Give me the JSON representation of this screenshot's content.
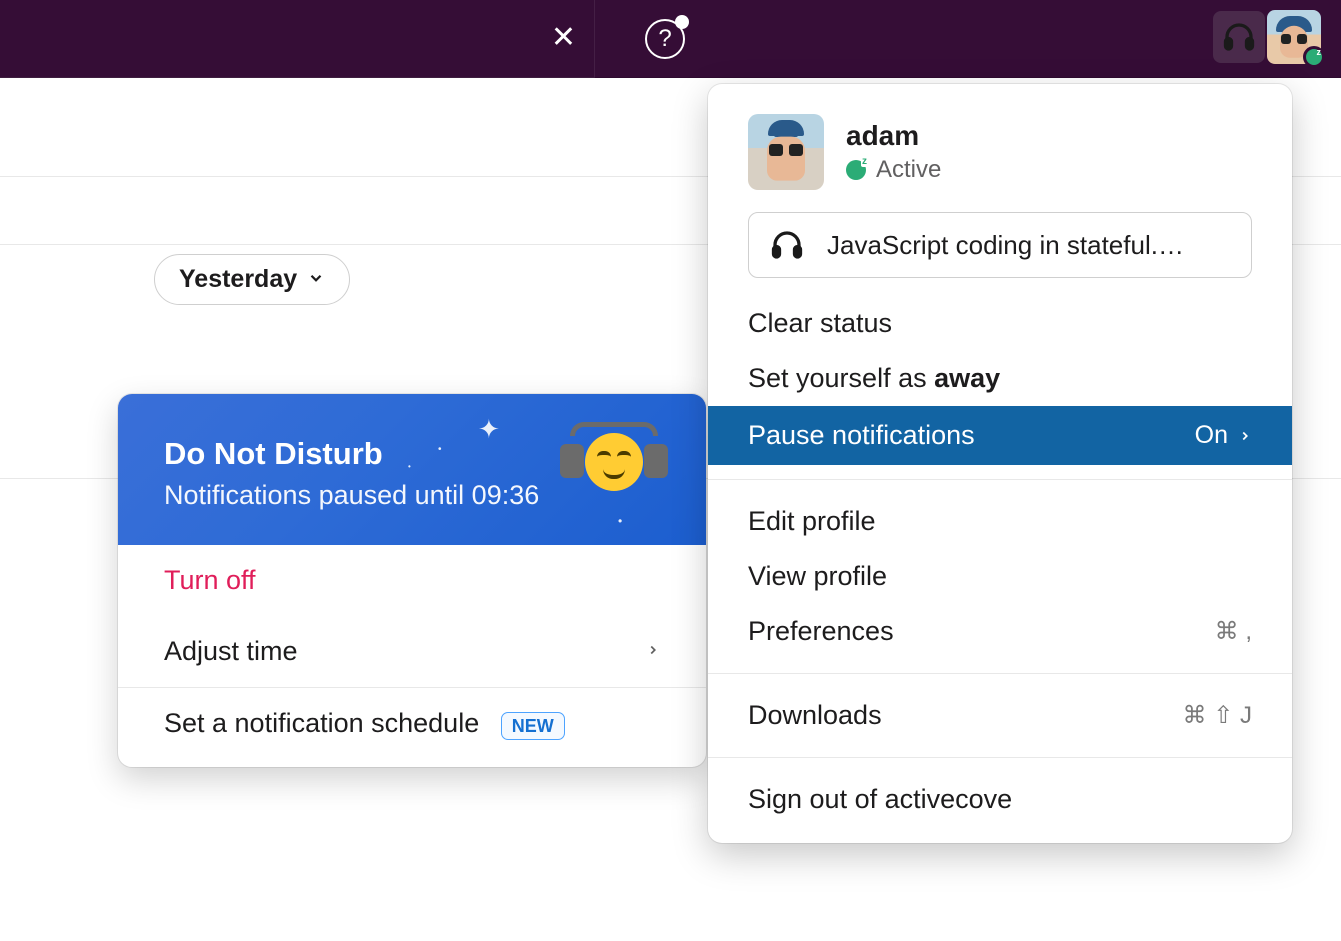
{
  "topbar": {
    "close": "✕",
    "help": "?"
  },
  "date_pill": "Yesterday",
  "dnd": {
    "title": "Do Not Disturb",
    "subtitle": "Notifications paused until 09:36",
    "turn_off": "Turn off",
    "adjust_time": "Adjust time",
    "schedule": "Set a notification schedule",
    "new_badge": "NEW"
  },
  "profile": {
    "name": "adam",
    "presence_label": "Active",
    "status_text": "JavaScript coding in stateful.…",
    "clear_status": "Clear status",
    "set_away_prefix": "Set yourself as ",
    "set_away_bold": "away",
    "pause_notifications": "Pause notifications",
    "pause_state": "On",
    "edit_profile": "Edit profile",
    "view_profile": "View profile",
    "preferences": "Preferences",
    "preferences_shortcut": "⌘ ,",
    "downloads": "Downloads",
    "downloads_shortcut": "⌘ ⇧ J",
    "sign_out": "Sign out of activecove"
  }
}
